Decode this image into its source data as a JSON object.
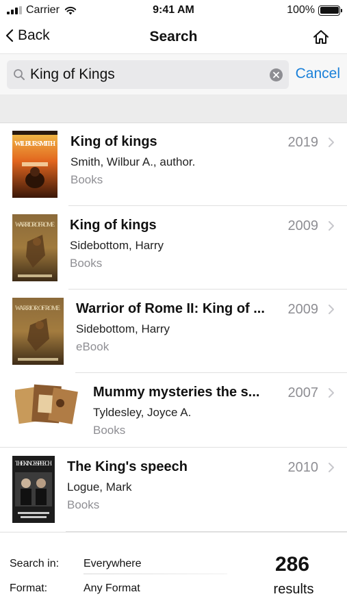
{
  "status_bar": {
    "carrier": "Carrier",
    "time": "9:41 AM",
    "battery": "100%"
  },
  "nav": {
    "back_label": "Back",
    "title": "Search",
    "home_icon": "home-icon"
  },
  "search": {
    "value": "King of Kings",
    "placeholder": "",
    "cancel_label": "Cancel"
  },
  "results": [
    {
      "title": "King of kings",
      "author": "Smith, Wilbur A., author.",
      "format": "Books",
      "year": "2019",
      "cover_text": "WILBUR SMITH"
    },
    {
      "title": "King of kings",
      "author": "Sidebottom, Harry",
      "format": "Books",
      "year": "2009",
      "cover_text": "WARRIOR OF ROME"
    },
    {
      "title": "Warrior of Rome II: King of ...",
      "author": "Sidebottom, Harry",
      "format": "eBook",
      "year": "2009",
      "cover_text": "WARRIOR OF ROME"
    },
    {
      "title": "Mummy mysteries the s...",
      "author": "Tyldesley, Joyce A.",
      "format": "Books",
      "year": "2007",
      "cover_text": ""
    },
    {
      "title": "The King's speech",
      "author": "Logue, Mark",
      "format": "Books",
      "year": "2010",
      "cover_text": "THE KING'S SPEECH"
    }
  ],
  "footer": {
    "search_in_label": "Search in:",
    "search_in_value": "Everywhere",
    "format_label": "Format:",
    "format_value": "Any Format",
    "results_count": "286",
    "results_label": "results"
  },
  "colors": {
    "accent": "#1a80d9",
    "secondary_text": "#8e8e93",
    "band": "#ececec"
  }
}
